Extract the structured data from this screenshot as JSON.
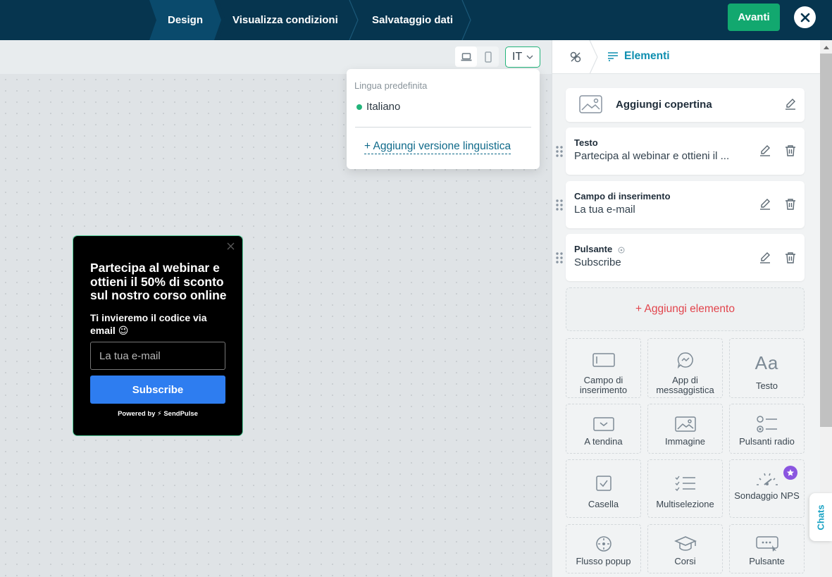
{
  "topbar": {
    "steps": [
      "Design",
      "Visualizza condizioni",
      "Salvataggio dati"
    ],
    "next_label": "Avanti",
    "close_icon": "close-icon"
  },
  "toolbar": {
    "desktop_icon": "laptop-icon",
    "mobile_icon": "mobile-icon",
    "language_code": "IT"
  },
  "language_popover": {
    "default_label": "Lingua predefinita",
    "default_language": "Italiano",
    "add_label": "+ Aggiungi versione linguistica"
  },
  "preview": {
    "title": "Partecipa al webinar e ottieni il 50% di sconto sul nostro corso online",
    "subtitle": "Ti invieremo il codice via email 😉",
    "input_placeholder": "La tua e-mail",
    "button_label": "Subscribe",
    "powered_by": "Powered by ⚡ SendPulse"
  },
  "panel": {
    "title": "Elementi",
    "cover_label": "Aggiungi copertina",
    "elements": [
      {
        "title": "Testo",
        "value": "Partecipa al webinar e ottieni il ..."
      },
      {
        "title": "Campo di inserimento",
        "value": "La tua e-mail"
      },
      {
        "title": "Pulsante",
        "value": "Subscribe"
      }
    ],
    "add_element_label": "+ Aggiungi elemento",
    "tiles": [
      {
        "label": "Campo di inserimento",
        "icon": "input-field-icon"
      },
      {
        "label": "App di messaggistica",
        "icon": "messenger-icon"
      },
      {
        "label": "Testo",
        "icon": "text-icon"
      },
      {
        "label": "A tendina",
        "icon": "dropdown-icon"
      },
      {
        "label": "Immagine",
        "icon": "image-icon"
      },
      {
        "label": "Pulsanti radio",
        "icon": "radio-buttons-icon"
      },
      {
        "label": "Casella",
        "icon": "checkbox-icon"
      },
      {
        "label": "Multiselezione",
        "icon": "multiselect-icon"
      },
      {
        "label": "Sondaggio NPS",
        "icon": "nps-icon"
      },
      {
        "label": "Flusso popup",
        "icon": "popup-flow-icon"
      },
      {
        "label": "Corsi",
        "icon": "courses-icon"
      },
      {
        "label": "Pulsante",
        "icon": "button-icon"
      }
    ]
  },
  "chats_label": "Chats",
  "colors": {
    "topbar": "#06354f",
    "accent_green": "#12a86f",
    "teal": "#0f8fb0",
    "danger": "#e2454d",
    "preview_button": "#2e7df0"
  }
}
